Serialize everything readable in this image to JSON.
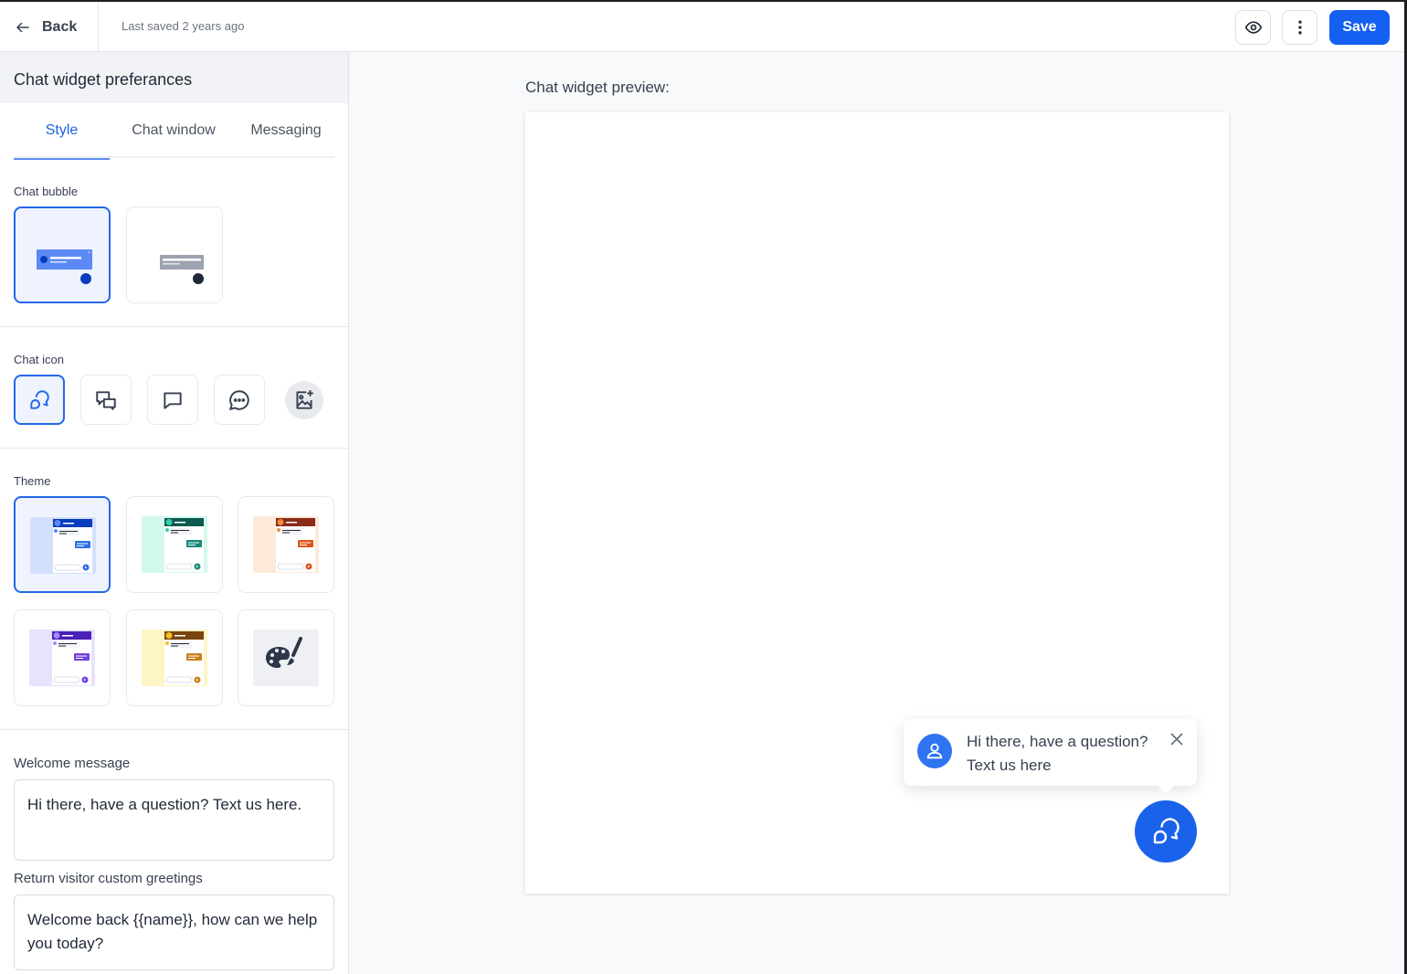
{
  "topbar": {
    "back_label": "Back",
    "last_saved": "Last saved 2 years ago",
    "preview_icon": "eye-icon",
    "more_icon": "vertical-dots-icon",
    "save_label": "Save"
  },
  "panel": {
    "title": "Chat widget preferances",
    "tabs": [
      {
        "label": "Style",
        "active": true
      },
      {
        "label": "Chat window",
        "active": false
      },
      {
        "label": "Messaging",
        "active": false
      }
    ],
    "chat_bubble": {
      "label": "Chat bubble",
      "options": [
        {
          "name": "colored-bubble",
          "selected": true
        },
        {
          "name": "neutral-bubble",
          "selected": false
        }
      ]
    },
    "chat_icon": {
      "label": "Chat icon",
      "options": [
        {
          "icon": "double-bubble-icon",
          "selected": true
        },
        {
          "icon": "two-square-bubbles-icon",
          "selected": false
        },
        {
          "icon": "square-bubble-icon",
          "selected": false
        },
        {
          "icon": "ellipsis-bubble-icon",
          "selected": false
        },
        {
          "icon": "add-image-icon",
          "selected": false
        }
      ]
    },
    "theme": {
      "label": "Theme",
      "options": [
        {
          "name": "blue",
          "selected": true,
          "bg": "#d3e0fc",
          "header": "#0a3cc0",
          "accent": "#2f6ee6",
          "dot": "#5b8af5"
        },
        {
          "name": "teal",
          "selected": false,
          "bg": "#d3f8ec",
          "header": "#0f5a4e",
          "accent": "#168a78",
          "dot": "#2fcfa8"
        },
        {
          "name": "orange",
          "selected": false,
          "bg": "#fde9d9",
          "header": "#8a2a18",
          "accent": "#e0541c",
          "dot": "#f08a3c"
        },
        {
          "name": "purple",
          "selected": false,
          "bg": "#e6e3fc",
          "header": "#4a1fb8",
          "accent": "#7040e0",
          "dot": "#a08af5"
        },
        {
          "name": "yellow",
          "selected": false,
          "bg": "#fdf5c6",
          "header": "#7a4410",
          "accent": "#c8801c",
          "dot": "#f5c020"
        },
        {
          "name": "custom",
          "selected": false,
          "icon": "palette-brush-icon"
        }
      ]
    },
    "welcome_message": {
      "label": "Welcome message",
      "value": "Hi there, have a question? Text us here."
    },
    "return_greeting": {
      "label": "Return visitor custom greetings",
      "value": "Welcome back {{name}}, how can we help you today?"
    }
  },
  "preview": {
    "label": "Chat widget preview:",
    "popup_text": "Hi there, have a question? Text us here",
    "accent": "#1a62ea"
  }
}
